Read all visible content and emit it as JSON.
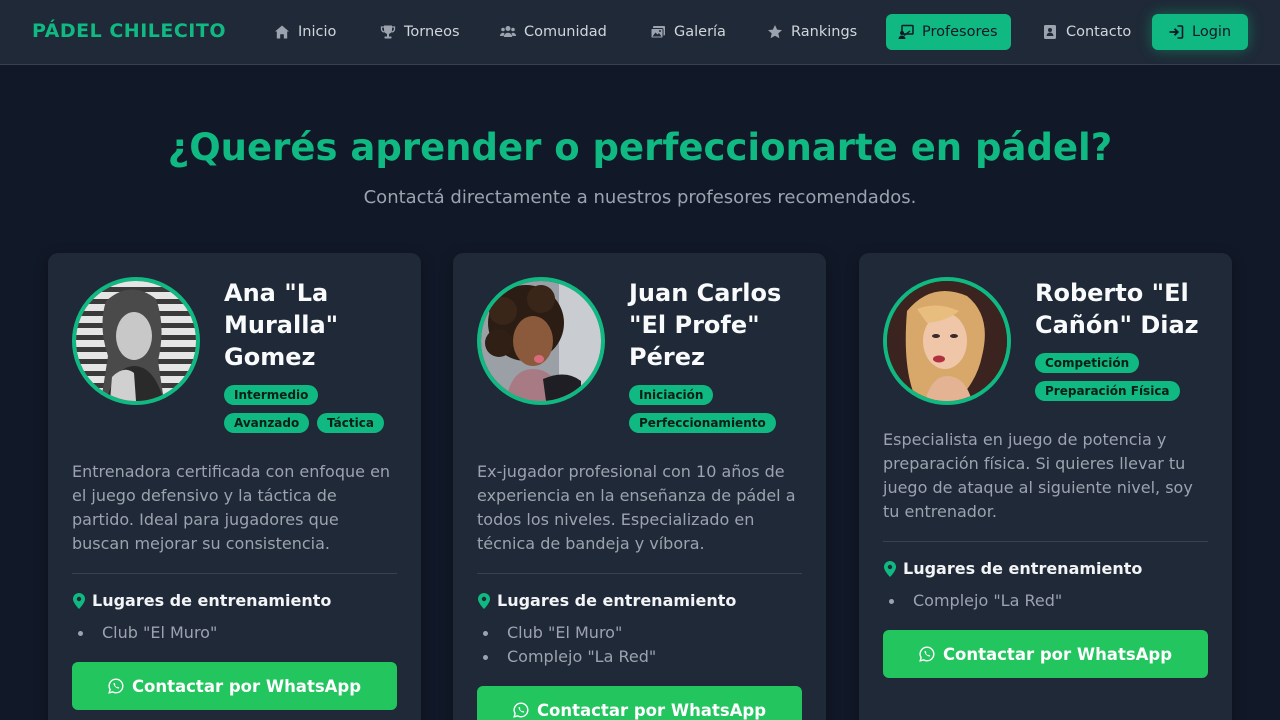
{
  "brand": "PÁDEL CHILECITO",
  "nav": {
    "items": [
      {
        "label": "Inicio",
        "icon": "home-icon"
      },
      {
        "label": "Torneos",
        "icon": "trophy-icon"
      },
      {
        "label": "Comunidad",
        "icon": "users-icon"
      },
      {
        "label": "Galería",
        "icon": "images-icon"
      },
      {
        "label": "Rankings",
        "icon": "star-icon"
      },
      {
        "label": "Profesores",
        "icon": "teacher-icon",
        "active": true
      },
      {
        "label": "Contacto",
        "icon": "contact-card-icon"
      }
    ],
    "login": {
      "label": "Login",
      "icon": "sign-in-icon"
    }
  },
  "hero": {
    "title": "¿Querés aprender o perfeccionarte en pádel?",
    "subtitle": "Contactá directamente a nuestros profesores recomendados."
  },
  "colors": {
    "accent": "#10b981",
    "whatsapp": "#22c55e",
    "background": "#111827",
    "card": "#1f2937"
  },
  "cards": [
    {
      "name": "Ana \"La Muralla\" Gomez",
      "tags": [
        "Intermedio",
        "Avanzado",
        "Táctica"
      ],
      "description": "Entrenadora certificada con enfoque en el juego defensivo y la táctica de partido. Ideal para jugadores que buscan mejorar su consistencia.",
      "places_title": "Lugares de entrenamiento",
      "places": [
        "Club \"El Muro\""
      ],
      "button": "Contactar por WhatsApp"
    },
    {
      "name": "Juan Carlos \"El Profe\" Pérez",
      "tags": [
        "Iniciación",
        "Perfeccionamiento"
      ],
      "description": "Ex-jugador profesional con 10 años de experiencia en la enseñanza de pádel a todos los niveles. Especializado en técnica de bandeja y víbora.",
      "places_title": "Lugares de entrenamiento",
      "places": [
        "Club \"El Muro\"",
        "Complejo \"La Red\""
      ],
      "button": "Contactar por WhatsApp"
    },
    {
      "name": "Roberto \"El Cañón\" Diaz",
      "tags": [
        "Competición",
        "Preparación Física"
      ],
      "description": "Especialista en juego de potencia y preparación física. Si quieres llevar tu juego de ataque al siguiente nivel, soy tu entrenador.",
      "places_title": "Lugares de entrenamiento",
      "places": [
        "Complejo \"La Red\""
      ],
      "button": "Contactar por WhatsApp"
    }
  ]
}
